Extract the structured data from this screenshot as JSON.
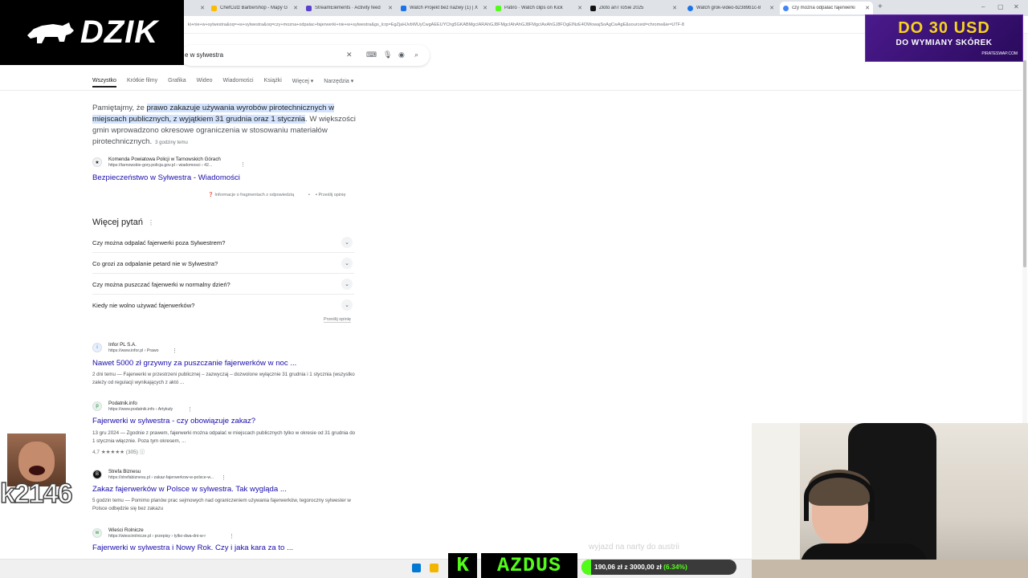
{
  "browser": {
    "tabs": [
      {
        "label": "ChefCutz Barbershop - Mapy G",
        "color": "#fbbc04"
      },
      {
        "label": "StreamElements · Activity feed",
        "color": "#5a3fd1"
      },
      {
        "label": "Watch Projekt bez nazwy (1) | X",
        "color": "#1a73e8"
      },
      {
        "label": "Patiro · Watch clips on Kick",
        "color": "#53fc18"
      },
      {
        "label": "Złoto anTToSie 2025",
        "color": "#111111"
      },
      {
        "label": "Watch grok-video-b2389b1c-8",
        "color": "#1a73e8"
      },
      {
        "label": "czy można odpalać fajerwerki",
        "color": "#4285f4"
      }
    ],
    "url": "+w+sylwestra&oq=czy+mozna+odpalac+fajerwerki+nie+w+sylwestra&gs_lcrp=EgZjaHJvbWUyCwgAEEUYChg5GKABMgcIARAhGJ8FMgcIAhAhGJ8FMgcIAxAhGJ8FOgEINzE4OWowajSoAgCwAgE&sourceid=chrome&ie=UTF-8",
    "url_prefix": "ki+nie+w+sylwestra&oq="
  },
  "overlay": {
    "logo": "DZIK",
    "ad_line1": "DO 30 USD",
    "ad_line2": "DO WYMIANY SKÓREK",
    "ad_brand": "PIRATESWAP.COM",
    "user_number": "k2146",
    "ghost_caption": "wyjazd na narty do austrii",
    "k_letter": "K",
    "streamer": "AZDUS",
    "goal": {
      "current": "190,06 zł",
      "separator": "z",
      "target": "3000,00 zł",
      "percent": "(6.34%)",
      "fraction": 0.0634
    }
  },
  "search": {
    "query": "e w sylwestra",
    "filters": [
      "Wszystko",
      "Krótkie filmy",
      "Grafika",
      "Wideo",
      "Wiadomości",
      "Książki",
      "Więcej ▾",
      "Narzędzia ▾"
    ]
  },
  "snippet": {
    "pre": "Pamiętajmy, że ",
    "highlight": "prawo zakazuje używania wyrobów pirotechnicznych w miejscach publicznych, z wyjątkiem 31 grudnia oraz 1 stycznia",
    "post": ". W większości gmin wprowadzono okresowe ograniczenia w stosowaniu materiałów pirotechnicznych.",
    "age": "3 godziny temu",
    "source_name": "Komenda Powiatowa Policji w Tarnowskich Górach",
    "source_url": "https://tarnowskie-gory.policja.gov.pl › wiadomosci › 42...",
    "link": "Bezpieczeństwo w Sylwestra - Wiadomości",
    "about": "Informacje o fragmentach z odpowiedzią",
    "feedback": "Prześlij opinię"
  },
  "paa": {
    "title": "Więcej pytań",
    "items": [
      "Czy można odpalać fajerwerki poza Sylwestrem?",
      "Co grozi za odpalanie petard nie w Sylwestra?",
      "Czy można puszczać fajerwerki w normalny dzień?",
      "Kiedy nie wolno używać fajerwerków?"
    ],
    "feedback": "Prześlij opinię"
  },
  "results": [
    {
      "name": "Infor PL S.A.",
      "url": "https://www.infor.pl › Prawo",
      "title": "Nawet 5000 zł grzywny za puszczanie fajerwerków w noc ...",
      "desc": "2 dni temu — Fajerwerki w przestrzeni publicznej – zazwyczaj – dozwolone wyłącznie 31 grudnia i 1 stycznia (wszystko zależy od regulacji wynikających z aktó ...",
      "fav": "i"
    },
    {
      "name": "Podatnik.info",
      "url": "https://www.podatnik.info › Artykuły",
      "title": "Fajerwerki w sylwestra - czy obowiązuje zakaz?",
      "desc": "13 gru 2024 — Zgodnie z prawem, fajerwerki można odpalać w miejscach publicznych tylko w okresie od 31 grudnia do 1 stycznia włącznie. Poza tym okresem, ...",
      "rating": "4,7 ★★★★★ (305)",
      "fav": "p"
    },
    {
      "name": "Strefa Biznesu",
      "url": "https://strefabiznesu.pl › zakaz-fajerwerkow-w-polsce-w...",
      "title": "Zakaz fajerwerków w Polsce w sylwestra. Tak wygląda ...",
      "desc": "5 godzin temu — Pomimo planów prac sejmowych nad ograniczeniem używania fajerwerków, tegoroczny sylwester w Polsce odbędzie się bez zakazu",
      "fav": "B"
    },
    {
      "name": "Wieści Rolnicze",
      "url": "https://wiescirolnicze.pl › przepisy › tylko-dwa-dni-w-r",
      "title": "Fajerwerki w sylwestra i Nowy Rok. Czy i jaka kara za to ...",
      "desc": "",
      "fav": "w"
    }
  ]
}
